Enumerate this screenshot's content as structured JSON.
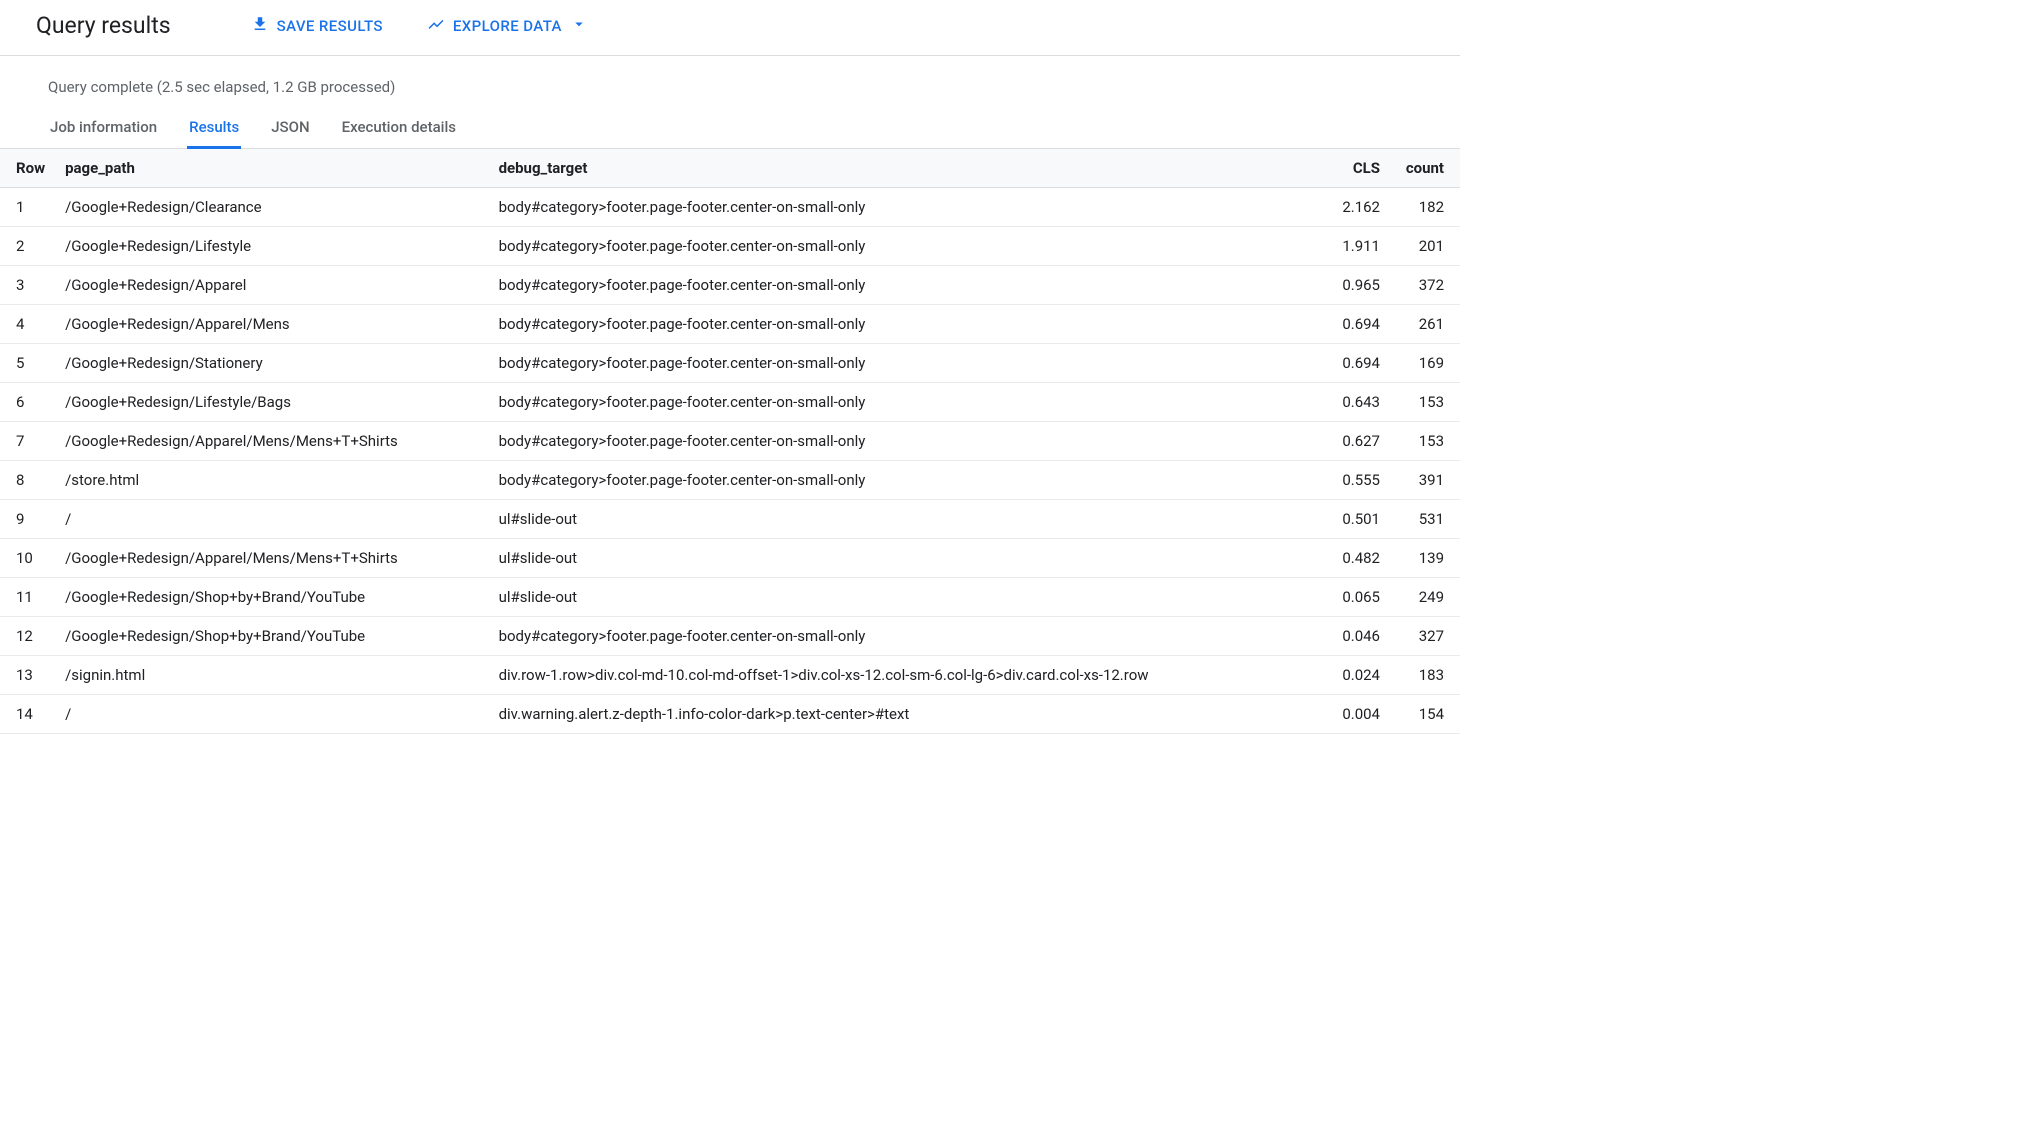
{
  "header": {
    "title": "Query results",
    "save_results_label": "SAVE RESULTS",
    "explore_data_label": "EXPLORE DATA"
  },
  "status": "Query complete (2.5 sec elapsed, 1.2 GB processed)",
  "tabs": {
    "job_info": "Job information",
    "results": "Results",
    "json": "JSON",
    "execution": "Execution details"
  },
  "table": {
    "columns": {
      "row": "Row",
      "page_path": "page_path",
      "debug_target": "debug_target",
      "cls": "CLS",
      "count": "count"
    },
    "rows": [
      {
        "row": "1",
        "page_path": "/Google+Redesign/Clearance",
        "debug_target": "body#category>footer.page-footer.center-on-small-only",
        "cls": "2.162",
        "count": "182"
      },
      {
        "row": "2",
        "page_path": "/Google+Redesign/Lifestyle",
        "debug_target": "body#category>footer.page-footer.center-on-small-only",
        "cls": "1.911",
        "count": "201"
      },
      {
        "row": "3",
        "page_path": "/Google+Redesign/Apparel",
        "debug_target": "body#category>footer.page-footer.center-on-small-only",
        "cls": "0.965",
        "count": "372"
      },
      {
        "row": "4",
        "page_path": "/Google+Redesign/Apparel/Mens",
        "debug_target": "body#category>footer.page-footer.center-on-small-only",
        "cls": "0.694",
        "count": "261"
      },
      {
        "row": "5",
        "page_path": "/Google+Redesign/Stationery",
        "debug_target": "body#category>footer.page-footer.center-on-small-only",
        "cls": "0.694",
        "count": "169"
      },
      {
        "row": "6",
        "page_path": "/Google+Redesign/Lifestyle/Bags",
        "debug_target": "body#category>footer.page-footer.center-on-small-only",
        "cls": "0.643",
        "count": "153"
      },
      {
        "row": "7",
        "page_path": "/Google+Redesign/Apparel/Mens/Mens+T+Shirts",
        "debug_target": "body#category>footer.page-footer.center-on-small-only",
        "cls": "0.627",
        "count": "153"
      },
      {
        "row": "8",
        "page_path": "/store.html",
        "debug_target": "body#category>footer.page-footer.center-on-small-only",
        "cls": "0.555",
        "count": "391"
      },
      {
        "row": "9",
        "page_path": "/",
        "debug_target": "ul#slide-out",
        "cls": "0.501",
        "count": "531"
      },
      {
        "row": "10",
        "page_path": "/Google+Redesign/Apparel/Mens/Mens+T+Shirts",
        "debug_target": "ul#slide-out",
        "cls": "0.482",
        "count": "139"
      },
      {
        "row": "11",
        "page_path": "/Google+Redesign/Shop+by+Brand/YouTube",
        "debug_target": "ul#slide-out",
        "cls": "0.065",
        "count": "249"
      },
      {
        "row": "12",
        "page_path": "/Google+Redesign/Shop+by+Brand/YouTube",
        "debug_target": "body#category>footer.page-footer.center-on-small-only",
        "cls": "0.046",
        "count": "327"
      },
      {
        "row": "13",
        "page_path": "/signin.html",
        "debug_target": "div.row-1.row>div.col-md-10.col-md-offset-1>div.col-xs-12.col-sm-6.col-lg-6>div.card.col-xs-12.row",
        "cls": "0.024",
        "count": "183"
      },
      {
        "row": "14",
        "page_path": "/",
        "debug_target": "div.warning.alert.z-depth-1.info-color-dark>p.text-center>#text",
        "cls": "0.004",
        "count": "154"
      }
    ]
  }
}
